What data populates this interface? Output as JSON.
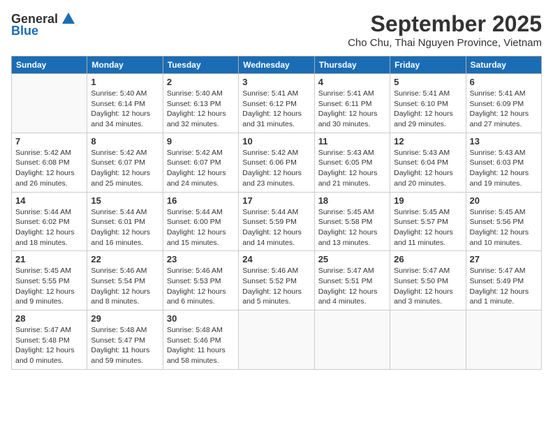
{
  "logo": {
    "general": "General",
    "blue": "Blue"
  },
  "title": {
    "month": "September 2025",
    "location": "Cho Chu, Thai Nguyen Province, Vietnam"
  },
  "headers": [
    "Sunday",
    "Monday",
    "Tuesday",
    "Wednesday",
    "Thursday",
    "Friday",
    "Saturday"
  ],
  "weeks": [
    [
      {
        "day": "",
        "info": ""
      },
      {
        "day": "1",
        "info": "Sunrise: 5:40 AM\nSunset: 6:14 PM\nDaylight: 12 hours\nand 34 minutes."
      },
      {
        "day": "2",
        "info": "Sunrise: 5:40 AM\nSunset: 6:13 PM\nDaylight: 12 hours\nand 32 minutes."
      },
      {
        "day": "3",
        "info": "Sunrise: 5:41 AM\nSunset: 6:12 PM\nDaylight: 12 hours\nand 31 minutes."
      },
      {
        "day": "4",
        "info": "Sunrise: 5:41 AM\nSunset: 6:11 PM\nDaylight: 12 hours\nand 30 minutes."
      },
      {
        "day": "5",
        "info": "Sunrise: 5:41 AM\nSunset: 6:10 PM\nDaylight: 12 hours\nand 29 minutes."
      },
      {
        "day": "6",
        "info": "Sunrise: 5:41 AM\nSunset: 6:09 PM\nDaylight: 12 hours\nand 27 minutes."
      }
    ],
    [
      {
        "day": "7",
        "info": "Sunrise: 5:42 AM\nSunset: 6:08 PM\nDaylight: 12 hours\nand 26 minutes."
      },
      {
        "day": "8",
        "info": "Sunrise: 5:42 AM\nSunset: 6:07 PM\nDaylight: 12 hours\nand 25 minutes."
      },
      {
        "day": "9",
        "info": "Sunrise: 5:42 AM\nSunset: 6:07 PM\nDaylight: 12 hours\nand 24 minutes."
      },
      {
        "day": "10",
        "info": "Sunrise: 5:42 AM\nSunset: 6:06 PM\nDaylight: 12 hours\nand 23 minutes."
      },
      {
        "day": "11",
        "info": "Sunrise: 5:43 AM\nSunset: 6:05 PM\nDaylight: 12 hours\nand 21 minutes."
      },
      {
        "day": "12",
        "info": "Sunrise: 5:43 AM\nSunset: 6:04 PM\nDaylight: 12 hours\nand 20 minutes."
      },
      {
        "day": "13",
        "info": "Sunrise: 5:43 AM\nSunset: 6:03 PM\nDaylight: 12 hours\nand 19 minutes."
      }
    ],
    [
      {
        "day": "14",
        "info": "Sunrise: 5:44 AM\nSunset: 6:02 PM\nDaylight: 12 hours\nand 18 minutes."
      },
      {
        "day": "15",
        "info": "Sunrise: 5:44 AM\nSunset: 6:01 PM\nDaylight: 12 hours\nand 16 minutes."
      },
      {
        "day": "16",
        "info": "Sunrise: 5:44 AM\nSunset: 6:00 PM\nDaylight: 12 hours\nand 15 minutes."
      },
      {
        "day": "17",
        "info": "Sunrise: 5:44 AM\nSunset: 5:59 PM\nDaylight: 12 hours\nand 14 minutes."
      },
      {
        "day": "18",
        "info": "Sunrise: 5:45 AM\nSunset: 5:58 PM\nDaylight: 12 hours\nand 13 minutes."
      },
      {
        "day": "19",
        "info": "Sunrise: 5:45 AM\nSunset: 5:57 PM\nDaylight: 12 hours\nand 11 minutes."
      },
      {
        "day": "20",
        "info": "Sunrise: 5:45 AM\nSunset: 5:56 PM\nDaylight: 12 hours\nand 10 minutes."
      }
    ],
    [
      {
        "day": "21",
        "info": "Sunrise: 5:45 AM\nSunset: 5:55 PM\nDaylight: 12 hours\nand 9 minutes."
      },
      {
        "day": "22",
        "info": "Sunrise: 5:46 AM\nSunset: 5:54 PM\nDaylight: 12 hours\nand 8 minutes."
      },
      {
        "day": "23",
        "info": "Sunrise: 5:46 AM\nSunset: 5:53 PM\nDaylight: 12 hours\nand 6 minutes."
      },
      {
        "day": "24",
        "info": "Sunrise: 5:46 AM\nSunset: 5:52 PM\nDaylight: 12 hours\nand 5 minutes."
      },
      {
        "day": "25",
        "info": "Sunrise: 5:47 AM\nSunset: 5:51 PM\nDaylight: 12 hours\nand 4 minutes."
      },
      {
        "day": "26",
        "info": "Sunrise: 5:47 AM\nSunset: 5:50 PM\nDaylight: 12 hours\nand 3 minutes."
      },
      {
        "day": "27",
        "info": "Sunrise: 5:47 AM\nSunset: 5:49 PM\nDaylight: 12 hours\nand 1 minute."
      }
    ],
    [
      {
        "day": "28",
        "info": "Sunrise: 5:47 AM\nSunset: 5:48 PM\nDaylight: 12 hours\nand 0 minutes."
      },
      {
        "day": "29",
        "info": "Sunrise: 5:48 AM\nSunset: 5:47 PM\nDaylight: 11 hours\nand 59 minutes."
      },
      {
        "day": "30",
        "info": "Sunrise: 5:48 AM\nSunset: 5:46 PM\nDaylight: 11 hours\nand 58 minutes."
      },
      {
        "day": "",
        "info": ""
      },
      {
        "day": "",
        "info": ""
      },
      {
        "day": "",
        "info": ""
      },
      {
        "day": "",
        "info": ""
      }
    ]
  ]
}
